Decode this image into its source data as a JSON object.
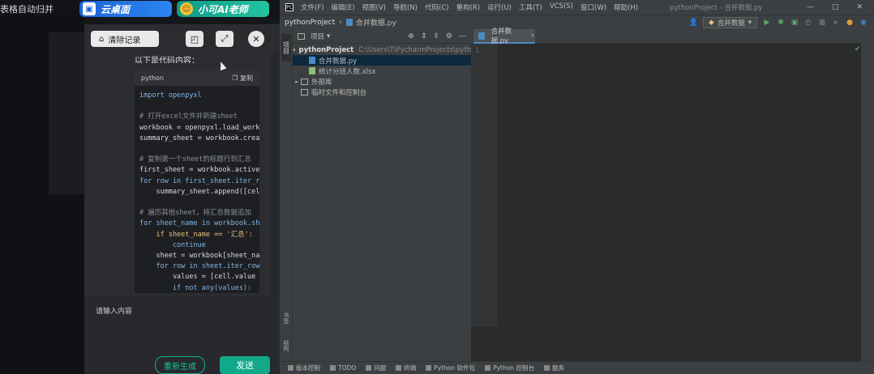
{
  "browser": {
    "left_title": "表格自动归并",
    "cloud_tab": "云桌面",
    "ai_tab": "小可AI老师",
    "cloud_icon": "cloud-desktop-icon",
    "ai_icon": "ai-teacher-avatar-icon"
  },
  "chat": {
    "clear_label": "清除记录",
    "window_icon": "window-icon",
    "expand_icon": "expand-icon",
    "close_icon": "close-icon",
    "text_fragment": "以下是代码内容：",
    "code_lang": "python",
    "copy_label": "复制",
    "code_lines": [
      {
        "t": "import openpyxl",
        "c": "kw"
      },
      {
        "t": "",
        "c": ""
      },
      {
        "t": "# 打开excel文件并新建sheet",
        "c": "cm"
      },
      {
        "t": "workbook = openpyxl.load_workbook(",
        "c": ""
      },
      {
        "t": "summary_sheet = workbook.create_",
        "c": ""
      },
      {
        "t": "",
        "c": ""
      },
      {
        "t": "# 复制第一个sheet的标题行到汇总",
        "c": "cm"
      },
      {
        "t": "first_sheet = workbook.active",
        "c": ""
      },
      {
        "t": "for row in first_sheet.iter_row",
        "c": "kw"
      },
      {
        "t": "    summary_sheet.append([cell",
        "c": ""
      },
      {
        "t": "",
        "c": ""
      },
      {
        "t": "# 遍历其他sheet，将汇总数据追加",
        "c": "cm"
      },
      {
        "t": "for sheet_name in workbook.shee",
        "c": "kw"
      },
      {
        "t": "    if sheet_name == '汇总':",
        "c": "str"
      },
      {
        "t": "        continue",
        "c": "kw"
      },
      {
        "t": "    sheet = workbook[sheet_nam",
        "c": ""
      },
      {
        "t": "    for row in sheet.iter_rows",
        "c": "kw"
      },
      {
        "t": "        values = [cell.value fo",
        "c": ""
      },
      {
        "t": "        if not any(values):",
        "c": "kw"
      }
    ],
    "input_placeholder": "请输入内容",
    "regen_label": "重新生成",
    "send_label": "发送"
  },
  "ide": {
    "logo": "PC",
    "menu": [
      "文件(F)",
      "编辑(E)",
      "视图(V)",
      "导航(N)",
      "代码(C)",
      "重构(R)",
      "运行(U)",
      "工具(T)",
      "VCS(S)",
      "窗口(W)",
      "帮助(H)"
    ],
    "window_title": "pythonProject - 合并数据.py",
    "breadcrumb_project": "pythonProject",
    "breadcrumb_file": "合并数据.py",
    "run_config": "合并数据",
    "project_tab_label": "项目",
    "project_dropdown": "项目",
    "tree": {
      "root_name": "pythonProject",
      "root_path": "C:\\Users\\T\\PycharmProjects\\pythonP",
      "file1": "合并数据.py",
      "file2": "统计分班人数.xlsx",
      "external_libs": "外部库",
      "scratches": "临时文件和控制台"
    },
    "editor_tab": "合并数据.py",
    "line_number": "1",
    "left_tabs": {
      "bookmarks": "书签",
      "structure": "结构"
    },
    "bottom_tools": [
      "版本控制",
      "TODO",
      "问题",
      "终端",
      "Python 软件包",
      "Python 控制台",
      "服务"
    ]
  }
}
